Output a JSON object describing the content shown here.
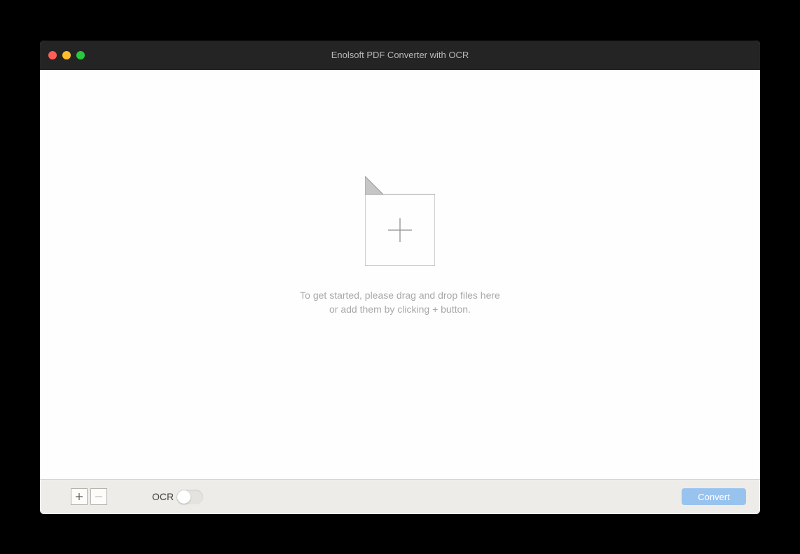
{
  "titlebar": {
    "title": "Enolsoft PDF Converter with OCR"
  },
  "emptyState": {
    "line1": "To get started, please drag and drop files here",
    "line2": "or add them by clicking + button."
  },
  "bottomBar": {
    "ocrLabel": "OCR",
    "ocrOn": false,
    "convertLabel": "Convert"
  }
}
